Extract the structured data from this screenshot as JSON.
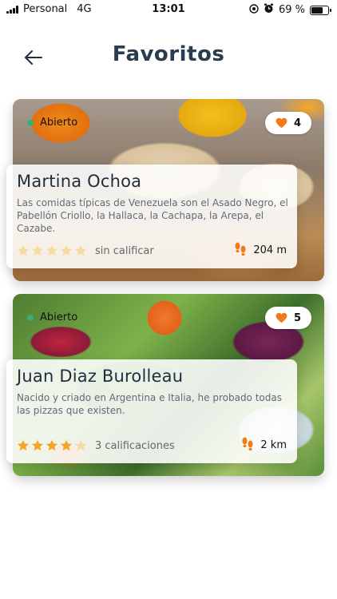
{
  "status_bar": {
    "carrier": "Personal",
    "network": "4G",
    "time": "13:01",
    "battery_percent": "69 %",
    "battery_level": 0.69
  },
  "header": {
    "title": "Favoritos",
    "back_icon": "arrow-left-icon"
  },
  "colors": {
    "accent_orange": "#f07a1a",
    "open_green": "#38b073",
    "star_gold": "#f5a524",
    "title_navy": "#2a3c50"
  },
  "favorites": [
    {
      "status": "Abierto",
      "likes": "4",
      "name": "Martina Ochoa",
      "description": "Las comidas típicas de Venezuela son el Asado Negro, el Pabellón Criollo, la Hallaca, la Cachapa, la Arepa, el Cazabe.",
      "rating": 0,
      "rating_label": "sin calificar",
      "distance": "204 m"
    },
    {
      "status": "Abierto",
      "likes": "5",
      "name": "Juan Diaz Burolleau",
      "description": "Nacido y criado en Argentina e Italia, he probado todas las pizzas que existen.",
      "rating": 4,
      "rating_label": "3 calificaciones",
      "distance": "2 km"
    }
  ]
}
